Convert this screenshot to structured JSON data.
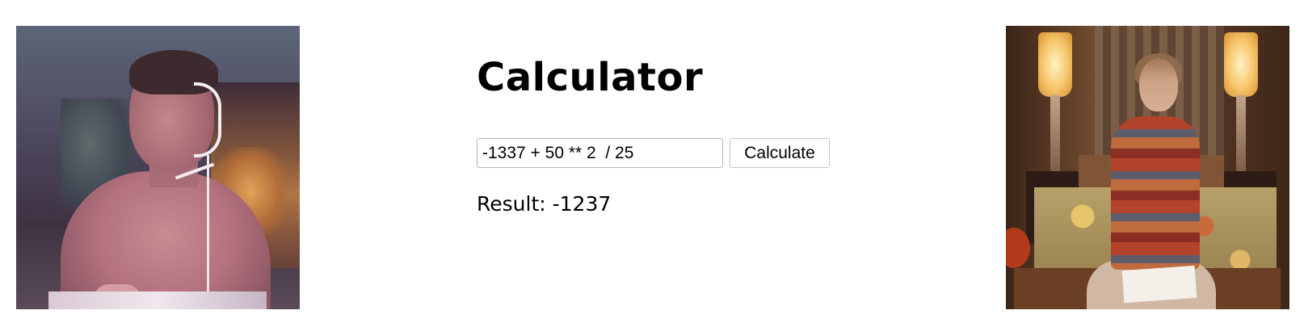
{
  "calculator": {
    "title": "Calculator",
    "input_value": "-1337 + 50 ** 2  / 25",
    "button_label": "Calculate",
    "result_label": "Result:",
    "result_value": "-1237"
  }
}
